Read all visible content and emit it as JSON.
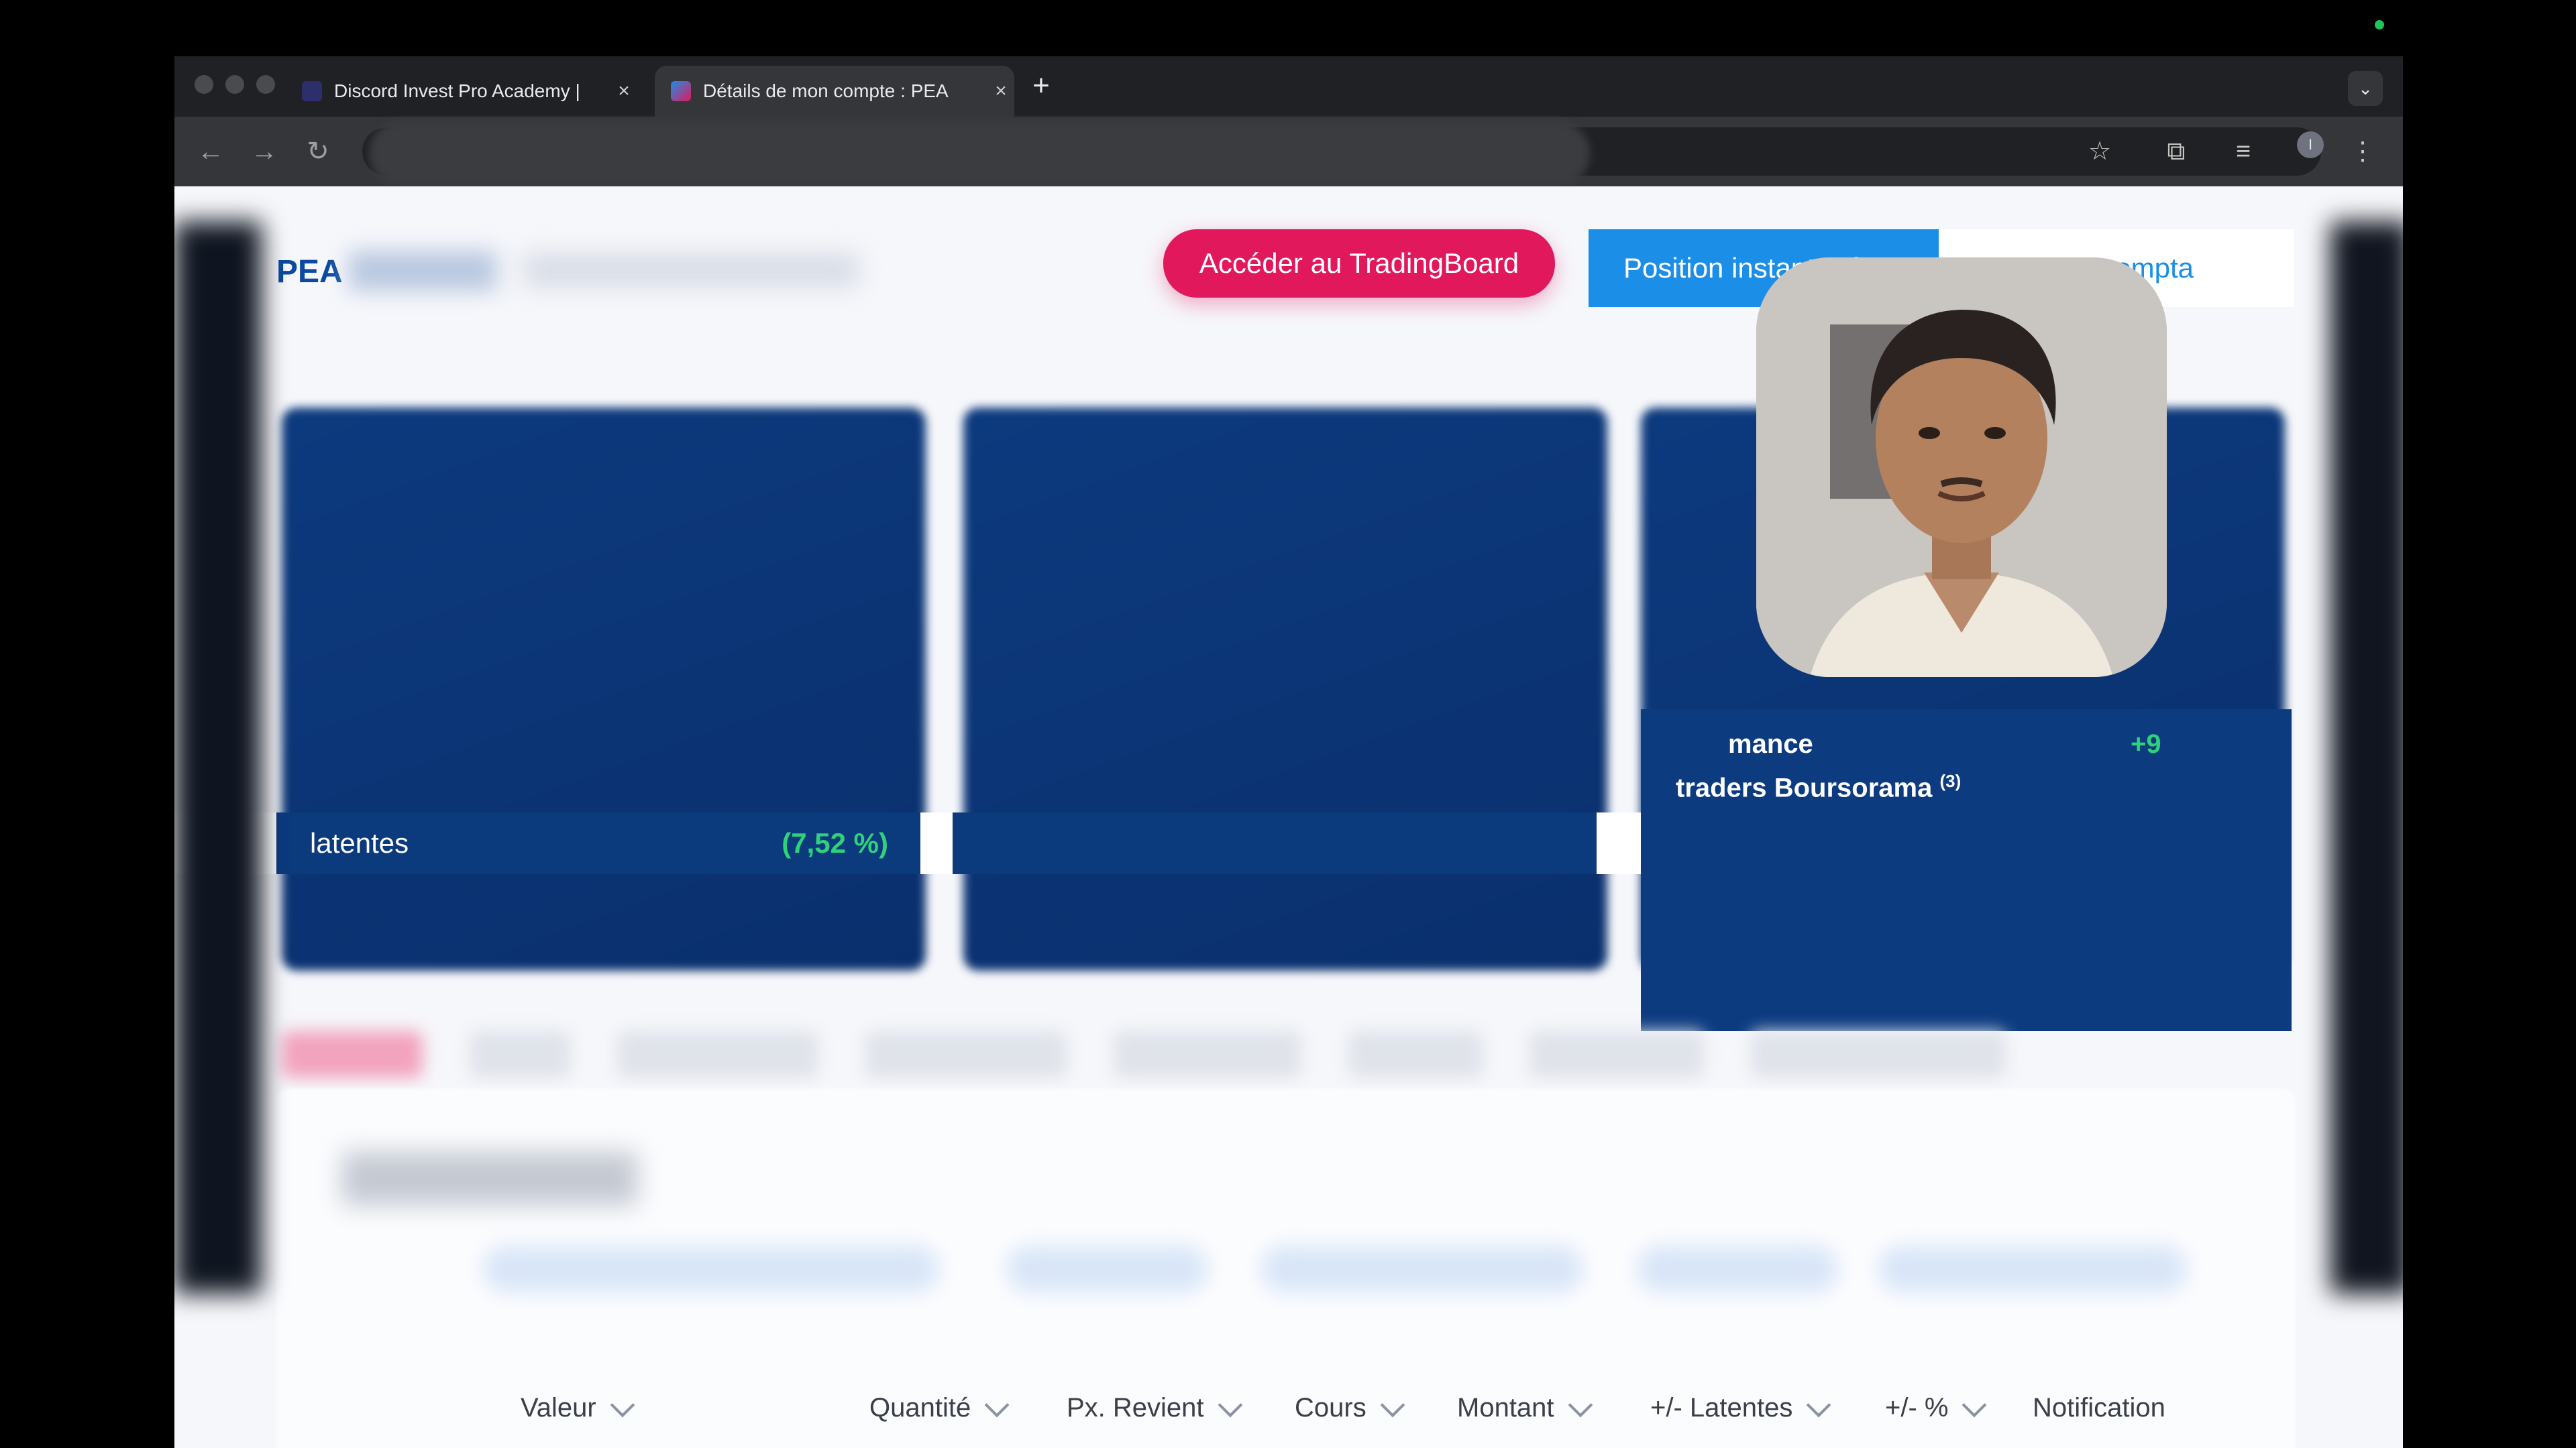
{
  "browser": {
    "tabs": [
      {
        "label": "Discord Invest Pro Academy |",
        "active": false,
        "favicon": "discord-icon"
      },
      {
        "label": "Détails de mon compte : PEA",
        "active": true,
        "favicon": "boursorama-icon"
      }
    ],
    "new_tab_symbol": "+",
    "tab_menu_symbol": "⌄",
    "nav": {
      "back": "←",
      "forward": "→",
      "reload": "↻"
    },
    "toolbar_icons": {
      "bookmark": "☆",
      "extensions": "⧉",
      "media": "≡",
      "menu": "⋮"
    },
    "profile_initial": "I"
  },
  "account": {
    "title": "PEA",
    "trade_button_label": "Accéder au TradingBoard",
    "tab_position_label": "Position instantanée",
    "tab_compte_label": "compta"
  },
  "summary": {
    "latentes_label": "latentes",
    "latentes_value": "(7,52 %)",
    "perf_line1": "mance",
    "perf_value": "+9",
    "perf_line2": "traders Boursorama",
    "perf_footnote": "(3)"
  },
  "table": {
    "columns": [
      "Valeur",
      "Quantité",
      "Px. Revient",
      "Cours",
      "Montant",
      "+/- Latentes",
      "+/- %",
      "Notification"
    ]
  },
  "colors": {
    "accent_pink": "#e1195c",
    "accent_blue": "#1b8ee8",
    "card_blue": "#0c3b80",
    "positive_green": "#2fd27a",
    "browser_dark": "#202124"
  }
}
